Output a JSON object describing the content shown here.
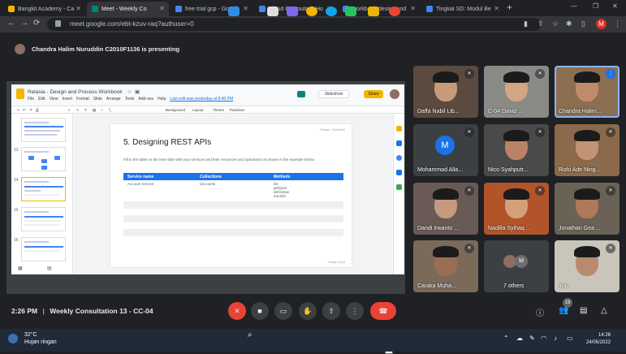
{
  "browser": {
    "tabs": [
      {
        "label": "Bangkit Academy - Ca",
        "favicon_color": "#f4b400",
        "active": false
      },
      {
        "label": "Meet - Weekly Co",
        "favicon_color": "#00897b",
        "active": true
      },
      {
        "label": "free trial gcp - Googl",
        "favicon_color": "#4285f4",
        "active": false
      },
      {
        "label": "Cloud Computing, Ho",
        "favicon_color": "#4285f4",
        "active": false
      },
      {
        "label": "workbook design and",
        "favicon_color": "#4285f4",
        "active": false
      },
      {
        "label": "Tingkat SD: Modul Be",
        "favicon_color": "#4285f4",
        "active": false
      }
    ],
    "new_tab": "+",
    "url": "meet.google.com/ebt-kzuv-raq?authuser=0",
    "profile_initial": "M"
  },
  "meet": {
    "presenter_banner": "Chandra Halim Nuruddin C2010F1136 is presenting",
    "meeting_time": "2:26 PM",
    "separator": "|",
    "meeting_title": "Weekly Consultation 13 - CC-04",
    "participant_count": "19",
    "participants": [
      {
        "name": "Daffa Nabil Lib...",
        "muted": true,
        "skin": "#c99a7a",
        "bg": "#5b4a3f"
      },
      {
        "name": "C-04 David ...",
        "muted": true,
        "skin": "#d2a583",
        "bg": "#8a8a86"
      },
      {
        "name": "Chandra Halim...",
        "muted": false,
        "speaking": true,
        "skin": "#c08b6a",
        "bg": "#8c6e50"
      },
      {
        "name": "Mohammad Alla...",
        "muted": true,
        "initial": "M",
        "bg": "#3c4043"
      },
      {
        "name": "Nico Syahputr...",
        "muted": true,
        "skin": "#b98465",
        "bg": "#4a4a4a"
      },
      {
        "name": "Rizki Ade Ning...",
        "muted": true,
        "skin": "#c39373",
        "bg": "#8a6a4a"
      },
      {
        "name": "Dandi Irwanto ...",
        "muted": true,
        "skin": "#c49b80",
        "bg": "#6a5a55"
      },
      {
        "name": "Nadilla Syihaq ...",
        "muted": true,
        "skin": "#d4a07a",
        "bg": "#b2542a"
      },
      {
        "name": "Jonathan Gea ...",
        "muted": true,
        "skin": "#b07a5a",
        "bg": "#6a6255"
      },
      {
        "name": "Caraka Muha...",
        "muted": true,
        "skin": "#9a6e55",
        "bg": "#7a6a5a"
      },
      {
        "name": "7 others",
        "muted": false,
        "others": true,
        "bg": "#3c4043"
      },
      {
        "name": "You",
        "muted": true,
        "skin": "#b88a6e",
        "bg": "#c9c5bb"
      }
    ]
  },
  "slides": {
    "doc_title": "Relasia - Design and Process Workbook",
    "menu": [
      "File",
      "Edit",
      "View",
      "Insert",
      "Format",
      "Slide",
      "Arrange",
      "Tools",
      "Add-ons",
      "Help"
    ],
    "last_edit": "Last edit was yesterday at 8:40 PM",
    "toolbar": [
      "Background",
      "Layout",
      "Theme",
      "Transition"
    ],
    "slideshow_label": "Slideshow",
    "share_label": "Share",
    "thumb_numbers": [
      "13",
      "14",
      "15",
      "16"
    ],
    "slide": {
      "heading": "5. Designing REST APIs",
      "instructions": "Fill in the table on the next slide with your services and their resources and operations as shown in the example below.",
      "columns": [
        "Service name",
        "Collections",
        "Methods"
      ],
      "row": {
        "service": "Account Service",
        "collection": "/accounts",
        "methods": [
          "list",
          "get/post",
          "with/draw",
          "transfer"
        ]
      },
      "footer_top": "Relasia - Workbook",
      "footer_bottom": "Google Cloud"
    }
  },
  "taskbar": {
    "temperature": "32°C",
    "weather_text": "Hujan ringan",
    "time": "14:26",
    "date": "24/05/2022"
  }
}
